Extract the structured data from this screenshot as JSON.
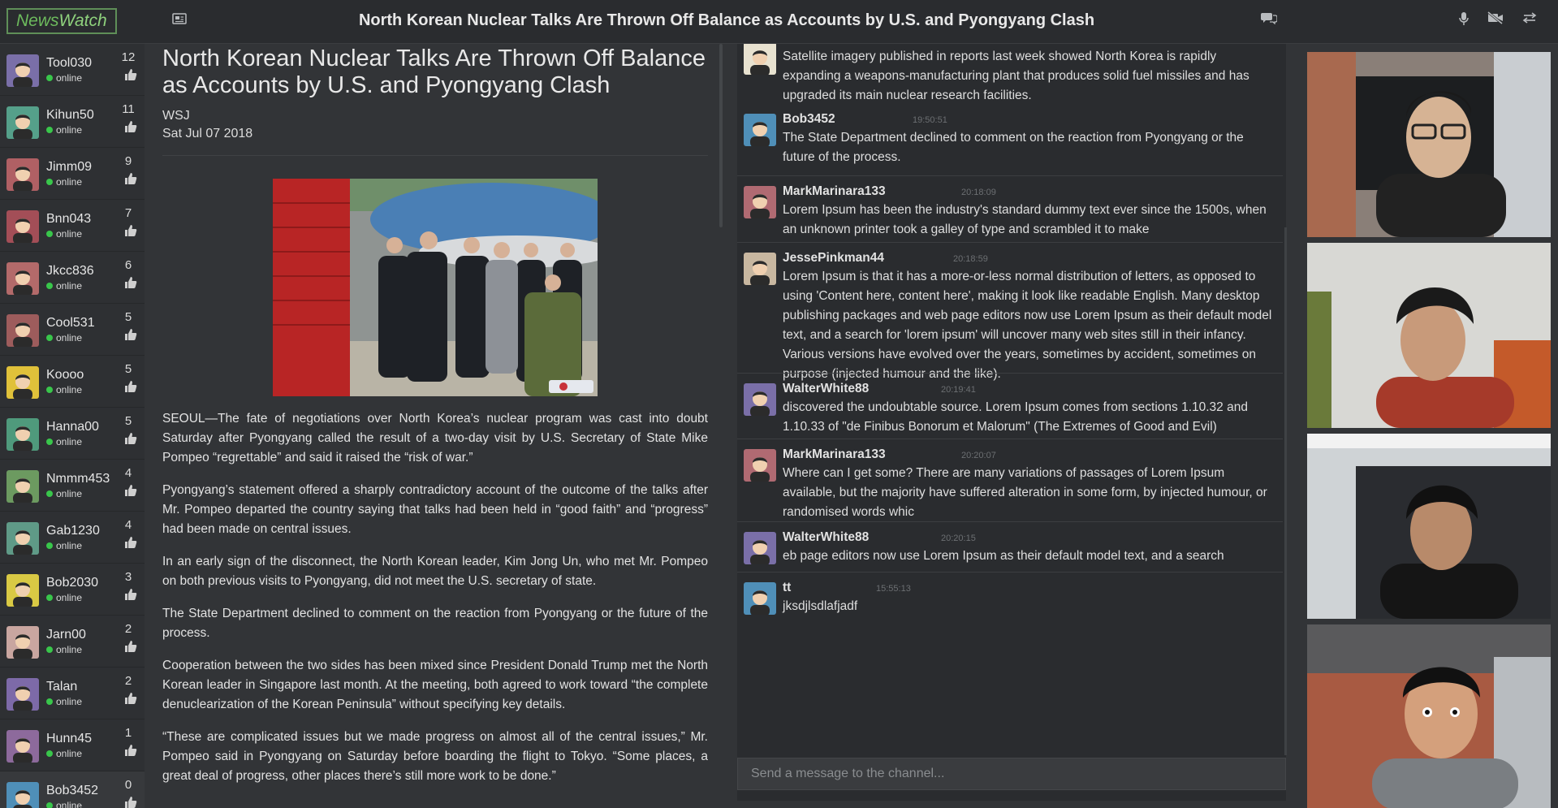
{
  "app": {
    "logo_prefix": "News",
    "logo_suffix": "Watch",
    "title": "North Korean Nuclear Talks Are Thrown Off Balance as Accounts by U.S. and Pyongyang Clash"
  },
  "toolbar_icons": [
    "news-icon",
    "chat-icon",
    "microphone-icon",
    "video-off-icon",
    "switch-icon"
  ],
  "users": [
    {
      "name": "Tool030",
      "status": "online",
      "likes": "12",
      "avatar_color": "#7a6fa8"
    },
    {
      "name": "Kihun50",
      "status": "online",
      "likes": "11",
      "avatar_color": "#55a08a"
    },
    {
      "name": "Jimm09",
      "status": "online",
      "likes": "9",
      "avatar_color": "#b06064"
    },
    {
      "name": "Bnn043",
      "status": "online",
      "likes": "7",
      "avatar_color": "#a34e57"
    },
    {
      "name": "Jkcc836",
      "status": "online",
      "likes": "6",
      "avatar_color": "#b36a6a"
    },
    {
      "name": "Cool531",
      "status": "online",
      "likes": "5",
      "avatar_color": "#9d5c5c"
    },
    {
      "name": "Koooo",
      "status": "online",
      "likes": "5",
      "avatar_color": "#e0c13a"
    },
    {
      "name": "Hanna00",
      "status": "online",
      "likes": "5",
      "avatar_color": "#4f9a7c"
    },
    {
      "name": "Nmmm453",
      "status": "online",
      "likes": "4",
      "avatar_color": "#6c9a60"
    },
    {
      "name": "Gab1230",
      "status": "online",
      "likes": "4",
      "avatar_color": "#5f9a87"
    },
    {
      "name": "Bob2030",
      "status": "online",
      "likes": "3",
      "avatar_color": "#d9c944"
    },
    {
      "name": "Jarn00",
      "status": "online",
      "likes": "2",
      "avatar_color": "#c9a6a0"
    },
    {
      "name": "Talan",
      "status": "online",
      "likes": "2",
      "avatar_color": "#7d6aa8"
    },
    {
      "name": "Hunn45",
      "status": "online",
      "likes": "1",
      "avatar_color": "#8d6a9c"
    },
    {
      "name": "Bob3452",
      "status": "online",
      "likes": "0",
      "avatar_color": "#4f8fb8"
    }
  ],
  "article": {
    "title": "North Korean Nuclear Talks Are Thrown Off Balance as Accounts by U.S. and Pyongyang Clash",
    "source": "WSJ",
    "date": "Sat Jul 07 2018",
    "paragraphs": [
      "SEOUL—The fate of negotiations over North Korea’s nuclear program was cast into doubt Saturday after Pyongyang called the result of a two-day visit by U.S. Secretary of State Mike Pompeo “regrettable” and said it raised the “risk of war.”",
      "Pyongyang’s statement offered a sharply contradictory account of the outcome of the talks after Mr. Pompeo departed the country saying that talks had been held in “good faith” and “progress” had been made on central issues.",
      "In an early sign of the disconnect, the North Korean leader, Kim Jong Un, who met Mr. Pompeo on both previous visits to Pyongyang, did not meet the U.S. secretary of state.",
      "The State Department declined to comment on the reaction from Pyongyang or the future of the process.",
      "Cooperation between the two sides has been mixed since President Donald Trump met the North Korean leader in Singapore last month. At the meeting, both agreed to work toward “the complete denuclearization of the Korean Peninsula” without specifying key details.",
      "“These are complicated issues but we made progress on almost all of the central issues,” Mr. Pompeo said in Pyongyang on Saturday before boarding the flight to Tokyo. “Some places, a great deal of progress, other places there’s still more work to be done.”"
    ]
  },
  "chat": {
    "messages": [
      {
        "author": "",
        "time": "",
        "text": "Satellite imagery published in reports last week showed North Korea is rapidly expanding a weapons-manufacturing plant that produces solid fuel missiles and has upgraded its main nuclear research facilities.",
        "avatar_color": "#e8e2d0"
      },
      {
        "author": "Bob3452",
        "time": "19:50:51",
        "text": "The State Department declined to comment on the reaction from Pyongyang or the future of the process.",
        "avatar_color": "#4f8fb8"
      },
      {
        "author": "MarkMarinara133",
        "time": "20:18:09",
        "text": "Lorem Ipsum has been the industry's standard dummy text ever since the 1500s, when an unknown printer took a galley of type and scrambled it to make",
        "avatar_color": "#b06a72"
      },
      {
        "author": "JessePinkman44",
        "time": "20:18:59",
        "text": "Lorem Ipsum is that it has a more-or-less normal distribution of letters, as opposed to using 'Content here, content here', making it look like readable English. Many desktop publishing packages and web page editors now use Lorem Ipsum as their default model text, and a search for 'lorem ipsum' will uncover many web sites still in their infancy. Various versions have evolved over the years, sometimes by accident, sometimes on purpose (injected humour and the like).",
        "avatar_color": "#c8b7a0"
      },
      {
        "author": "WalterWhite88",
        "time": "20:19:41",
        "text": "discovered the undoubtable source. Lorem Ipsum comes from sections 1.10.32 and 1.10.33 of \"de Finibus Bonorum et Malorum\" (The Extremes of Good and Evil)",
        "avatar_color": "#7a6fa8"
      },
      {
        "author": "MarkMarinara133",
        "time": "20:20:07",
        "text": "Where can I get some? There are many variations of passages of Lorem Ipsum available, but the majority have suffered alteration in some form, by injected humour, or randomised words whic",
        "avatar_color": "#b06a72"
      },
      {
        "author": "WalterWhite88",
        "time": "20:20:15",
        "text": "eb page editors now use Lorem Ipsum as their default model text, and a search",
        "avatar_color": "#7a6fa8"
      },
      {
        "author": "tt",
        "time": "15:55:13",
        "text": "jksdjlsdlafjadf",
        "avatar_color": "#4f8fb8"
      }
    ],
    "input_placeholder": "Send a message to the channel..."
  },
  "videos": [
    {
      "label": "video-feed-1"
    },
    {
      "label": "video-feed-2"
    },
    {
      "label": "video-feed-3"
    },
    {
      "label": "video-feed-4"
    }
  ],
  "colors": {
    "background": "#323437",
    "topbar": "#2a2c2f",
    "online": "#39c64b",
    "logo_green": "#6dbb5d"
  }
}
